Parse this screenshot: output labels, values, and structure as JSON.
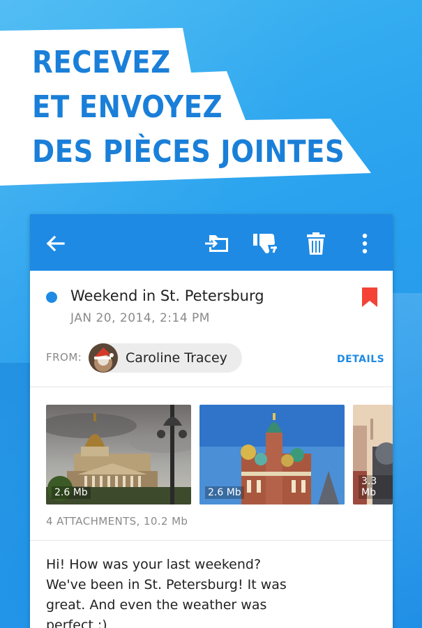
{
  "promo": {
    "headline_lines": [
      "RECEVEZ",
      "ET ENVOYEZ",
      "DES PIÈCES JOINTES"
    ]
  },
  "colors": {
    "brand_blue": "#1e8ae4",
    "headline_blue": "#1a7fd8",
    "flag_red": "#f44336",
    "background_blue": "#2aa2ee"
  },
  "toolbar": {
    "back_icon": "arrow-left-icon",
    "move_icon": "move-to-folder-icon",
    "spam_icon": "thumbs-down-icon",
    "delete_icon": "trash-icon",
    "more_icon": "more-vert-icon"
  },
  "message": {
    "subject": "Weekend in St. Petersburg",
    "date": "JAN 20, 2014, 2:14 PM",
    "from_label": "FROM:",
    "sender_name": "Caroline Tracey",
    "details_label": "DETAILS",
    "flagged": true
  },
  "attachments": {
    "items": [
      {
        "size": "2.6 Mb"
      },
      {
        "size": "2.6 Mb"
      },
      {
        "size": "3.3 Mb"
      }
    ],
    "summary": "4 ATTACHMENTS, 10.2 Mb"
  },
  "body": {
    "text": "Hi! How was your last weekend? We've been in St. Petersburg! It was great. And even the weather was perfect :)"
  }
}
